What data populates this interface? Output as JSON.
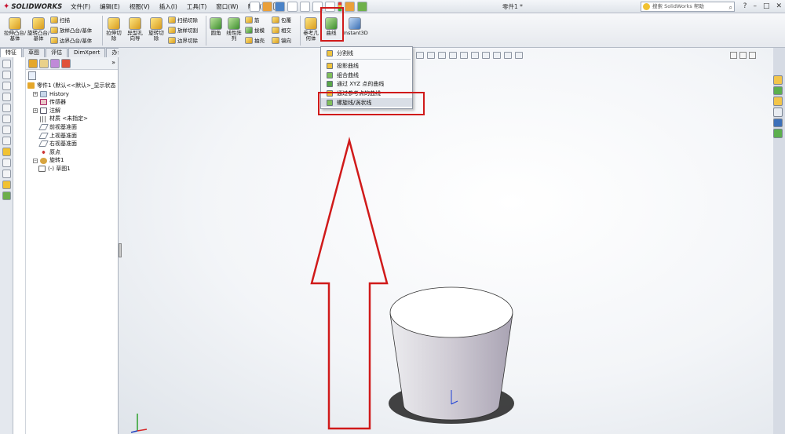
{
  "app": {
    "logo_text": "SOLIDWORKS",
    "doc_title": "零件1 *",
    "search_placeholder": "搜索 SolidWorks 帮助"
  },
  "menu": [
    "文件(F)",
    "编辑(E)",
    "视图(V)",
    "插入(I)",
    "工具(T)",
    "窗口(W)",
    "帮助(H)"
  ],
  "commands": {
    "extrude_boss": "拉伸凸台/基体",
    "revolve_boss": "旋转凸台/基体",
    "sweep": "扫描",
    "loft_boss": "放样凸台/基体",
    "boundary_boss": "边界凸台/基体",
    "extrude_cut": "拉伸切除",
    "hole_wizard": "异型孔向导",
    "revolve_cut": "旋转切除",
    "swept_cut": "扫描切除",
    "lofted_cut": "放样切割",
    "boundary_cut": "边界切除",
    "fillet": "圆角",
    "linear_pattern": "线性阵列",
    "rib": "筋",
    "draft": "拔模",
    "shell": "抽壳",
    "wrap": "包覆",
    "intersect": "相交",
    "mirror": "镜向",
    "reference_geometry": "参考几何体",
    "curves": "曲线",
    "instant3d": "Instant3D"
  },
  "tabs": [
    {
      "label": "特征",
      "active": true
    },
    {
      "label": "草图",
      "active": false
    },
    {
      "label": "评估",
      "active": false
    },
    {
      "label": "DimXpert",
      "active": false
    },
    {
      "label": "办公室产品",
      "active": false
    }
  ],
  "tree": [
    {
      "label": "零件1 (默认<<默认>_显示状态",
      "icon": "part",
      "indent": 0
    },
    {
      "label": "History",
      "icon": "hist",
      "indent": 1
    },
    {
      "label": "传感器",
      "icon": "sens",
      "indent": 1
    },
    {
      "label": "注解",
      "icon": "note",
      "indent": 1
    },
    {
      "label": "材质 <未指定>",
      "icon": "mat",
      "indent": 1
    },
    {
      "label": "前视基准面",
      "icon": "plane",
      "indent": 1
    },
    {
      "label": "上视基准面",
      "icon": "plane",
      "indent": 1
    },
    {
      "label": "右视基准面",
      "icon": "plane",
      "indent": 1
    },
    {
      "label": "原点",
      "icon": "orig",
      "indent": 1
    },
    {
      "label": "旋转1",
      "icon": "rev",
      "indent": 1
    },
    {
      "label": "(-) 草图1",
      "icon": "sk",
      "indent": 2
    }
  ],
  "curves_menu": [
    {
      "label": "分割线"
    },
    {
      "label": "投影曲线"
    },
    {
      "label": "组合曲线"
    },
    {
      "label": "通过 XYZ 点的曲线"
    },
    {
      "label": "通过参考点的曲线"
    },
    {
      "label": "螺旋线/涡状线",
      "highlighted": true
    }
  ],
  "colors": {
    "annotation_red": "#d01a1a",
    "cylinder_light": "#ffffff",
    "cylinder_side": "#c9c5cf"
  }
}
